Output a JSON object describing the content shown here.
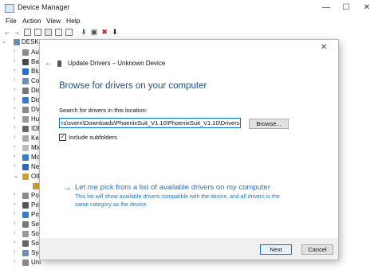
{
  "window": {
    "title": "Device Manager",
    "minimize": "—",
    "maximize": "☐",
    "close": "✕"
  },
  "menu": [
    "File",
    "Action",
    "View",
    "Help"
  ],
  "toolbar": {
    "back": "←",
    "forward": "→",
    "delete": "✖",
    "update": "⬇"
  },
  "tree": {
    "root": "DESKTOP",
    "items": [
      "Aud",
      "Bat",
      "Blu",
      "Con",
      "Disk",
      "Disp",
      "DVD",
      "Hum",
      "IDE",
      "Key",
      "Mic",
      "Mon",
      "Net",
      "Oth"
    ],
    "child": "",
    "items2": [
      "Por",
      "Prin",
      "Pro",
      "Sec",
      "Sof",
      "Sou",
      "Sys",
      "Uni"
    ]
  },
  "dialog": {
    "close": "✕",
    "back": "←",
    "header": "Update Drivers – Unknown Device",
    "heading": "Browse for drivers on your computer",
    "search_label": "Search for drivers in this location:",
    "path_value": "rs\\svern\\Downloads\\PhoenixSuit_V1.10\\PhoenixSuit_V1.10\\Drivers",
    "browse": "Browse...",
    "include_check": "✓",
    "include_label": "Include subfolders",
    "pick_arrow": "→",
    "pick_heading": "Let me pick from a list of available drivers on my computer",
    "pick_desc": "This list will show available drivers compatible with the device, and all drivers in the same category as the device.",
    "next": "Next",
    "cancel": "Cancel"
  },
  "colors": {
    "accent": "#0078d7",
    "link": "#1e77d1",
    "heading": "#1e4e8c",
    "footer": "#f0f0f0"
  }
}
